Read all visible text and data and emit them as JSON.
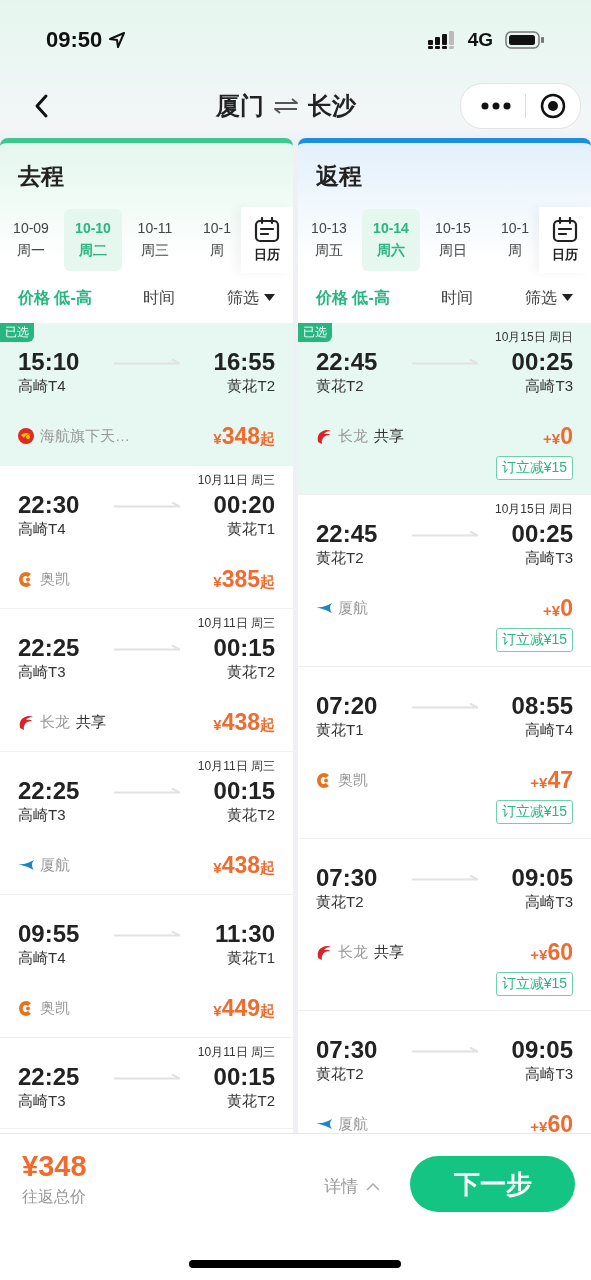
{
  "status_bar": {
    "time": "09:50",
    "network": "4G"
  },
  "nav": {
    "from": "厦门",
    "to": "长沙"
  },
  "columns": [
    {
      "title": "去程",
      "kind": "outbound",
      "dates": [
        {
          "date": "10-09",
          "weekday": "周一",
          "selected": false
        },
        {
          "date": "10-10",
          "weekday": "周二",
          "selected": true
        },
        {
          "date": "10-11",
          "weekday": "周三",
          "selected": false
        },
        {
          "date": "10-1",
          "weekday": "周",
          "selected": false
        }
      ],
      "calendar_label": "日历",
      "sorts": [
        {
          "label": "价格 低-高",
          "selected": true
        },
        {
          "label": "时间",
          "selected": false
        },
        {
          "label": "筛选",
          "selected": false,
          "dropdown": true
        }
      ],
      "flights": [
        {
          "selected": true,
          "badge": "已选",
          "dep_time": "15:10",
          "dep_airport": "高崎T4",
          "arr_time": "16:55",
          "arr_airport": "黄花T2",
          "airline": "海航旗下天…",
          "logo": {
            "kind": "red-circle"
          },
          "price_prefix": "¥",
          "price": "348",
          "price_suffix": "起"
        },
        {
          "selected": false,
          "note": "10月11日 周三",
          "dep_time": "22:30",
          "dep_airport": "高崎T4",
          "arr_time": "00:20",
          "arr_airport": "黄花T1",
          "airline": "奥凯",
          "logo": {
            "kind": "orange-c"
          },
          "price_prefix": "¥",
          "price": "385",
          "price_suffix": "起"
        },
        {
          "selected": false,
          "note": "10月11日 周三",
          "dep_time": "22:25",
          "dep_airport": "高崎T3",
          "arr_time": "00:15",
          "arr_airport": "黄花T2",
          "airline": "长龙",
          "shared": "共享",
          "logo": {
            "kind": "red-wing"
          },
          "price_prefix": "¥",
          "price": "438",
          "price_suffix": "起"
        },
        {
          "selected": false,
          "note": "10月11日 周三",
          "dep_time": "22:25",
          "dep_airport": "高崎T3",
          "arr_time": "00:15",
          "arr_airport": "黄花T2",
          "airline": "厦航",
          "logo": {
            "kind": "blue-bird"
          },
          "price_prefix": "¥",
          "price": "438",
          "price_suffix": "起"
        },
        {
          "selected": false,
          "dep_time": "09:55",
          "dep_airport": "高崎T4",
          "arr_time": "11:30",
          "arr_airport": "黄花T1",
          "airline": "奥凯",
          "logo": {
            "kind": "orange-c"
          },
          "price_prefix": "¥",
          "price": "449",
          "price_suffix": "起"
        },
        {
          "selected": false,
          "note": "10月11日 周三",
          "dep_time": "22:25",
          "dep_airport": "高崎T3",
          "arr_time": "00:15",
          "arr_airport": "黄花T2"
        }
      ]
    },
    {
      "title": "返程",
      "kind": "return",
      "dates": [
        {
          "date": "10-13",
          "weekday": "周五",
          "selected": false
        },
        {
          "date": "10-14",
          "weekday": "周六",
          "selected": true
        },
        {
          "date": "10-15",
          "weekday": "周日",
          "selected": false
        },
        {
          "date": "10-1",
          "weekday": "周",
          "selected": false
        }
      ],
      "calendar_label": "日历",
      "sorts": [
        {
          "label": "价格 低-高",
          "selected": true
        },
        {
          "label": "时间",
          "selected": false
        },
        {
          "label": "筛选",
          "selected": false,
          "dropdown": true
        }
      ],
      "flights": [
        {
          "selected": true,
          "badge": "已选",
          "note": "10月15日 周日",
          "dep_time": "22:45",
          "dep_airport": "黄花T2",
          "arr_time": "00:25",
          "arr_airport": "高崎T3",
          "airline": "长龙",
          "shared": "共享",
          "logo": {
            "kind": "red-wing"
          },
          "price_prefix": "+¥",
          "price": "0",
          "discount": "订立减¥15"
        },
        {
          "selected": false,
          "note": "10月15日 周日",
          "dep_time": "22:45",
          "dep_airport": "黄花T2",
          "arr_time": "00:25",
          "arr_airport": "高崎T3",
          "airline": "厦航",
          "logo": {
            "kind": "blue-bird"
          },
          "price_prefix": "+¥",
          "price": "0",
          "discount": "订立减¥15"
        },
        {
          "selected": false,
          "dep_time": "07:20",
          "dep_airport": "黄花T1",
          "arr_time": "08:55",
          "arr_airport": "高崎T4",
          "airline": "奥凯",
          "logo": {
            "kind": "orange-c"
          },
          "price_prefix": "+¥",
          "price": "47",
          "discount": "订立减¥15"
        },
        {
          "selected": false,
          "dep_time": "07:30",
          "dep_airport": "黄花T2",
          "arr_time": "09:05",
          "arr_airport": "高崎T3",
          "airline": "长龙",
          "shared": "共享",
          "logo": {
            "kind": "red-wing"
          },
          "price_prefix": "+¥",
          "price": "60",
          "discount": "订立减¥15"
        },
        {
          "selected": false,
          "dep_time": "07:30",
          "dep_airport": "黄花T2",
          "arr_time": "09:05",
          "arr_airport": "高崎T3",
          "airline": "厦航",
          "logo": {
            "kind": "blue-bird"
          },
          "price_prefix": "+¥",
          "price": "60"
        }
      ]
    }
  ],
  "footer": {
    "total": "¥348",
    "total_label": "往返总价",
    "details": "详情",
    "next": "下一步"
  }
}
